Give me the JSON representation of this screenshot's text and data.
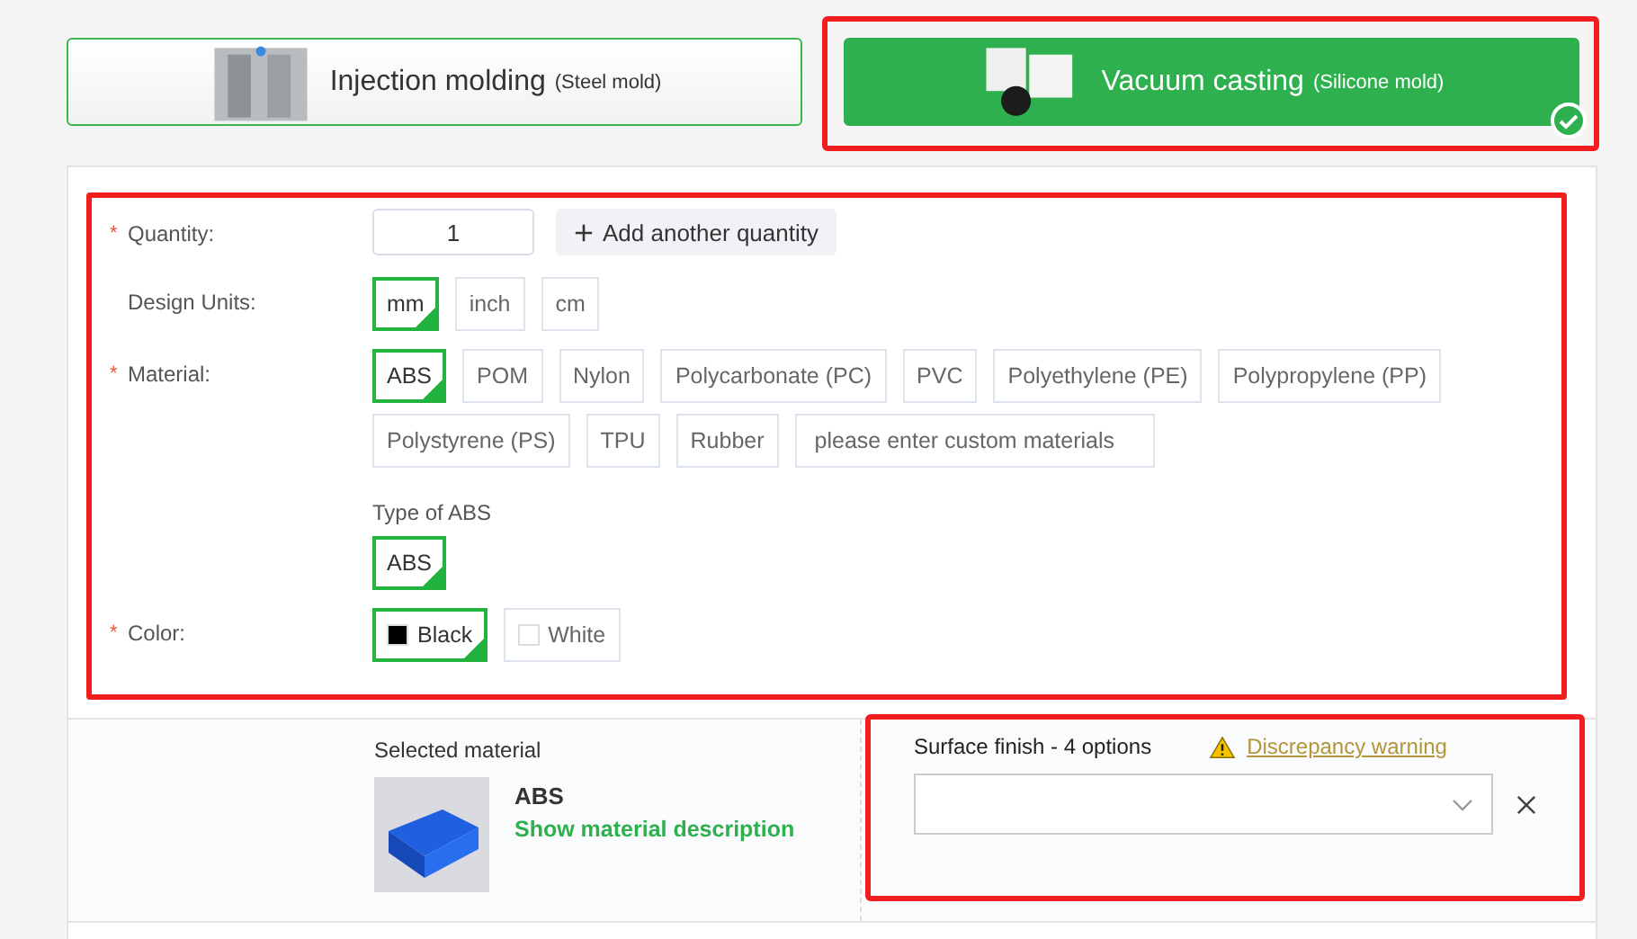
{
  "process_options": [
    {
      "title": "Injection molding",
      "subtitle": "(Steel mold)",
      "selected": false,
      "highlighted": false
    },
    {
      "title": "Vacuum casting",
      "subtitle": "(Silicone mold)",
      "selected": true,
      "highlighted": true
    }
  ],
  "form": {
    "highlighted": true,
    "quantity": {
      "label": "Quantity:",
      "required_mark": "*",
      "value": "1",
      "add_button": "Add another quantity"
    },
    "design_units": {
      "label": "Design Units:",
      "options": [
        {
          "label": "mm",
          "selected": true
        },
        {
          "label": "inch",
          "selected": false
        },
        {
          "label": "cm",
          "selected": false
        }
      ]
    },
    "material": {
      "label": "Material:",
      "required_mark": "*",
      "options": [
        {
          "label": "ABS",
          "selected": true
        },
        {
          "label": "POM",
          "selected": false
        },
        {
          "label": "Nylon",
          "selected": false
        },
        {
          "label": "Polycarbonate (PC)",
          "selected": false
        },
        {
          "label": "PVC",
          "selected": false
        },
        {
          "label": "Polyethylene (PE)",
          "selected": false
        },
        {
          "label": "Polypropylene (PP)",
          "selected": false
        },
        {
          "label": "Polystyrene (PS)",
          "selected": false
        },
        {
          "label": "TPU",
          "selected": false
        },
        {
          "label": "Rubber",
          "selected": false
        }
      ],
      "custom_placeholder": "please enter custom materials"
    },
    "material_type": {
      "label": "Type of ABS",
      "options": [
        {
          "label": "ABS",
          "selected": true
        }
      ]
    },
    "color": {
      "label": "Color:",
      "required_mark": "*",
      "options": [
        {
          "label": "Black",
          "selected": true,
          "color": "#000000"
        },
        {
          "label": "White",
          "selected": false,
          "color": "#ffffff"
        }
      ]
    }
  },
  "selected_material": {
    "heading": "Selected material",
    "name": "ABS",
    "link": "Show material description"
  },
  "surface_finish": {
    "highlighted": true,
    "label": "Surface finish - 4 options",
    "warning_link": "Discrepancy warning"
  }
}
